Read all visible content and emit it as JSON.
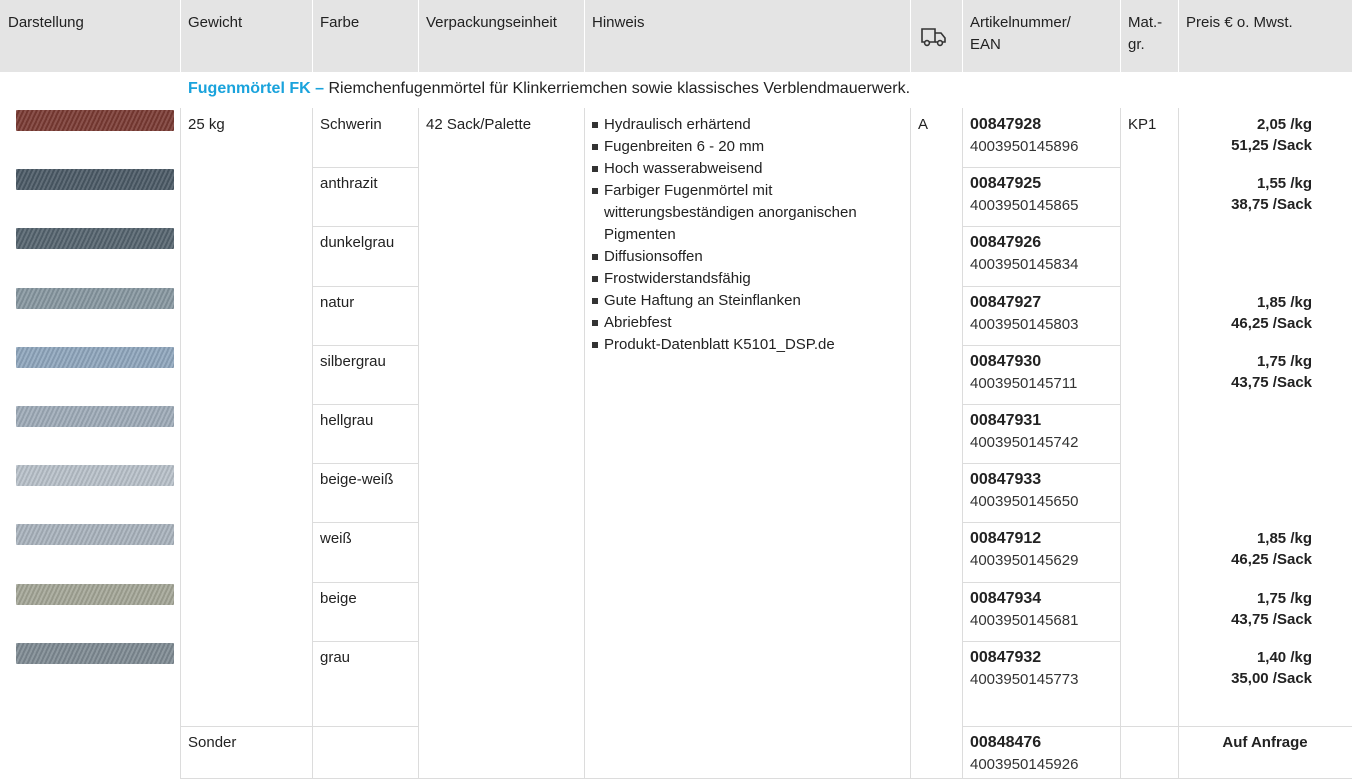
{
  "headers": {
    "darstellung": "Darstellung",
    "gewicht": "Gewicht",
    "farbe": "Farbe",
    "verpackung": "Verpackungseinheit",
    "hinweis": "Hinweis",
    "artikel_line1": "Artikelnummer/",
    "artikel_line2": "EAN",
    "matgr_line1": "Mat.-",
    "matgr_line2": "gr.",
    "preis": "Preis € o. Mwst.",
    "delivery_icon": "truck-icon"
  },
  "section": {
    "name": "Fugenmörtel FK –",
    "description": "Riemchenfugenmörtel für Klinkerriemchen sowie klassisches Verblendmauerwerk."
  },
  "product": {
    "gewicht": "25 kg",
    "verpackung": "42 Sack/Palette",
    "lieferung": "A",
    "matgr": "KP1",
    "sonder_label": "Sonder",
    "hints": [
      "Hydraulisch erhärtend",
      "Fugenbreiten 6 - 20 mm",
      "Hoch wasserabweisend",
      "Farbiger Fugenmörtel mit",
      "witterungsbeständigen anorganischen",
      "Pigmenten",
      "Diffusionsoffen",
      "Frostwiderstandsfähig",
      "Gute Haftung an Steinflanken",
      "Abriebfest",
      "Produkt-Datenblatt K5101_DSP.de"
    ]
  },
  "rows": [
    {
      "farbe": "Schwerin",
      "artikel": "00847928",
      "ean": "4003950145896",
      "price_kg": "2,05 /kg",
      "price_sack": "51,25 /Sack",
      "swatch": "#7a3a33"
    },
    {
      "farbe": "anthrazit",
      "artikel": "00847925",
      "ean": "4003950145865",
      "price_kg": "1,55 /kg",
      "price_sack": "38,75 /Sack",
      "swatch": "#4b5a66"
    },
    {
      "farbe": "dunkelgrau",
      "artikel": "00847926",
      "ean": "4003950145834",
      "price_kg": "",
      "price_sack": "",
      "swatch": "#55646f"
    },
    {
      "farbe": "natur",
      "artikel": "00847927",
      "ean": "4003950145803",
      "price_kg": "1,85 /kg",
      "price_sack": "46,25 /Sack",
      "swatch": "#8797a0"
    },
    {
      "farbe": "silbergrau",
      "artikel": "00847930",
      "ean": "4003950145711",
      "price_kg": "1,75 /kg",
      "price_sack": "43,75 /Sack",
      "swatch": "#8fa6bd"
    },
    {
      "farbe": "hellgrau",
      "artikel": "00847931",
      "ean": "4003950145742",
      "price_kg": "",
      "price_sack": "",
      "swatch": "#9eabb8"
    },
    {
      "farbe": "beige-weiß",
      "artikel": "00847933",
      "ean": "4003950145650",
      "price_kg": "",
      "price_sack": "",
      "swatch": "#b8c1ca"
    },
    {
      "farbe": "weiß",
      "artikel": "00847912",
      "ean": "4003950145629",
      "price_kg": "1,85 /kg",
      "price_sack": "46,25 /Sack",
      "swatch": "#a9b3bd"
    },
    {
      "farbe": "beige",
      "artikel": "00847934",
      "ean": "4003950145681",
      "price_kg": "1,75 /kg",
      "price_sack": "43,75 /Sack",
      "swatch": "#a4a697"
    },
    {
      "farbe": "grau",
      "artikel": "00847932",
      "ean": "4003950145773",
      "price_kg": "1,40 /kg",
      "price_sack": "35,00 /Sack",
      "swatch": "#7f8b93"
    }
  ],
  "sonder_row": {
    "artikel": "00848476",
    "ean": "4003950145926",
    "price": "Auf Anfrage"
  }
}
